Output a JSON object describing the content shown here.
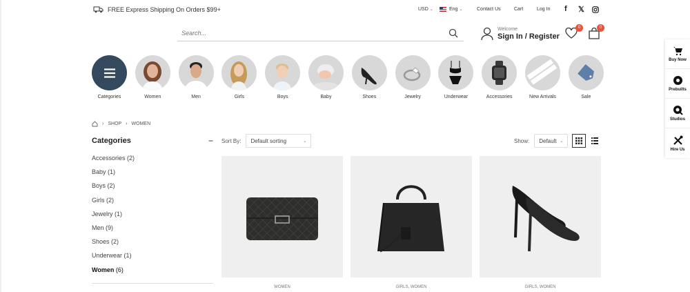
{
  "topbar": {
    "shipping_text": "FREE Express Shipping On Orders $99+",
    "currency": "USD",
    "language": "Eng",
    "contact": "Contact Us",
    "cart": "Cart",
    "login": "Log In"
  },
  "search": {
    "placeholder": "Search..."
  },
  "account": {
    "welcome": "Welcome",
    "signin": "Sign In / Register"
  },
  "wishlist": {
    "count": "0"
  },
  "cart": {
    "count": "0"
  },
  "categories_strip": [
    {
      "label": "Categories"
    },
    {
      "label": "Women"
    },
    {
      "label": "Men"
    },
    {
      "label": "Girls"
    },
    {
      "label": "Boys"
    },
    {
      "label": "Baby"
    },
    {
      "label": "Shoes"
    },
    {
      "label": "Jewelry"
    },
    {
      "label": "Underwear"
    },
    {
      "label": "Accessories"
    },
    {
      "label": "New Arrivals"
    },
    {
      "label": "Sale"
    }
  ],
  "breadcrumb": {
    "shop": "SHOP",
    "current": "WOMEN"
  },
  "sidebar": {
    "title": "Categories",
    "items": [
      {
        "label": "Accessories",
        "count": "(2)"
      },
      {
        "label": "Baby",
        "count": "(1)"
      },
      {
        "label": "Boys",
        "count": "(2)"
      },
      {
        "label": "Girls",
        "count": "(2)"
      },
      {
        "label": "Jewelry",
        "count": "(1)"
      },
      {
        "label": "Men",
        "count": "(9)"
      },
      {
        "label": "Shoes",
        "count": "(2)"
      },
      {
        "label": "Underwear",
        "count": "(1)"
      },
      {
        "label": "Women",
        "count": "(6)"
      }
    ]
  },
  "toolbar": {
    "sort_label": "Sort By:",
    "sort_value": "Default sorting",
    "show_label": "Show:",
    "show_value": "Default"
  },
  "products": [
    {
      "category": "WOMEN"
    },
    {
      "category": "GIRLS, WOMEN"
    },
    {
      "category": "GIRLS, WOMEN"
    }
  ],
  "floating": {
    "buy_now": "Buy Now",
    "prebuilts": "Prebuilts",
    "studios": "Studios",
    "hire_us": "Hire Us"
  },
  "colors": {
    "accent": "#e8553d",
    "category_dark": "#34495e"
  }
}
